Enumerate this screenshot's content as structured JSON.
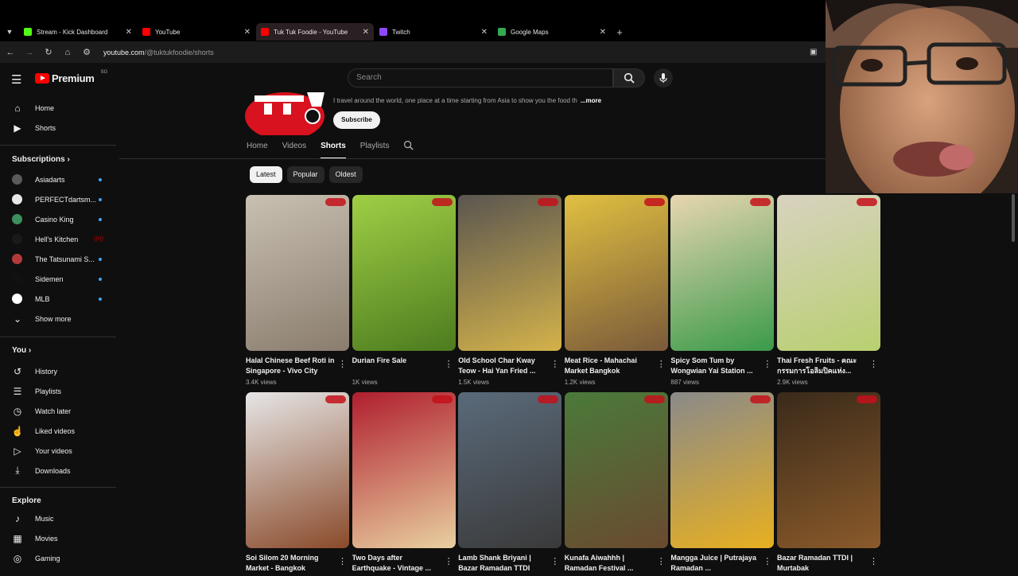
{
  "browser": {
    "tabs": [
      {
        "title": "Stream - Kick Dashboard",
        "color": "#53fc18",
        "active": false
      },
      {
        "title": "YouTube",
        "color": "#ff0000",
        "active": false
      },
      {
        "title": "Tuk Tuk Foodie - YouTube",
        "color": "#ff0000",
        "active": true
      },
      {
        "title": "Twitch",
        "color": "#9146ff",
        "active": false
      },
      {
        "title": "Google Maps",
        "color": "#34a853",
        "active": false
      }
    ],
    "url_host": "youtube.com",
    "url_path": "/@tuktukfoodie/shorts"
  },
  "header": {
    "logo": "Premium",
    "logo_sup": "SG",
    "search_placeholder": "Search"
  },
  "sidebar": {
    "main": [
      {
        "label": "Home",
        "icon": "home-icon"
      },
      {
        "label": "Shorts",
        "icon": "shorts-icon"
      }
    ],
    "subscriptions_title": "Subscriptions",
    "subscriptions": [
      {
        "label": "Asiadarts",
        "avatar_color": "#5a5a5a",
        "status": "dot"
      },
      {
        "label": "PERFECTdartsm...",
        "avatar_color": "#e8e8e8",
        "status": "dot"
      },
      {
        "label": "Casino King",
        "avatar_color": "#3c8f5c",
        "status": "dot"
      },
      {
        "label": "Hell's Kitchen",
        "avatar_color": "#1a1a1a",
        "status": "live"
      },
      {
        "label": "The Tatsunami S...",
        "avatar_color": "#b33a3a",
        "status": "dot"
      },
      {
        "label": "Sidemen",
        "avatar_color": "#111111",
        "status": "dot"
      },
      {
        "label": "MLB",
        "avatar_color": "#ffffff",
        "status": "dot"
      }
    ],
    "show_more": "Show more",
    "you_title": "You",
    "you": [
      {
        "label": "History",
        "icon": "history-icon"
      },
      {
        "label": "Playlists",
        "icon": "playlists-icon"
      },
      {
        "label": "Watch later",
        "icon": "watch-later-icon"
      },
      {
        "label": "Liked videos",
        "icon": "liked-icon"
      },
      {
        "label": "Your videos",
        "icon": "your-videos-icon"
      },
      {
        "label": "Downloads",
        "icon": "download-icon"
      }
    ],
    "explore_title": "Explore",
    "explore": [
      {
        "label": "Music",
        "icon": "music-icon"
      },
      {
        "label": "Movies",
        "icon": "movies-icon"
      },
      {
        "label": "Gaming",
        "icon": "gaming-icon"
      }
    ]
  },
  "channel": {
    "description": "I travel around the world, one place at a time starting from Asia to show you the food th",
    "more_label": "...more",
    "subscribe_label": "Subscribe",
    "tabs": [
      "Home",
      "Videos",
      "Shorts",
      "Playlists"
    ],
    "active_tab": "Shorts"
  },
  "filters": {
    "chips": [
      "Latest",
      "Popular",
      "Oldest"
    ],
    "active": "Latest"
  },
  "shorts": [
    {
      "title": "Halal Chinese Beef Roti in Singapore - Vivo City",
      "views": "3.4K views",
      "c1": "#c9c0b2",
      "c2": "#8a7d6e"
    },
    {
      "title": "Durian Fire Sale",
      "views": "1K views",
      "c1": "#9fcf45",
      "c2": "#4d7b1f"
    },
    {
      "title": "Old School Char Kway Teow - Hai Yan Fried ...",
      "views": "1.5K views",
      "c1": "#5a5650",
      "c2": "#d4b24a"
    },
    {
      "title": "Meat Rice - Mahachai Market Bangkok",
      "views": "1.2K views",
      "c1": "#e0c040",
      "c2": "#7a5a3a"
    },
    {
      "title": "Spicy Som Tum by Wongwian Yai Station ...",
      "views": "887 views",
      "c1": "#e8d6b0",
      "c2": "#3a9a4a"
    },
    {
      "title": "Thai Fresh Fruits - คณะกรรมการโอลิมปิคแห่ง...",
      "views": "2.9K views",
      "c1": "#d8d2c0",
      "c2": "#b8d070"
    },
    {
      "title": "Soi Silom 20 Morning Market - Bangkok",
      "views": "",
      "c1": "#e6e6e6",
      "c2": "#8a4a2a"
    },
    {
      "title": "Two Days after Earthquake - Vintage ...",
      "views": "",
      "c1": "#b01e2e",
      "c2": "#e8d0a0"
    },
    {
      "title": "Lamb Shank Briyani | Bazar Ramadan TTDI",
      "views": "",
      "c1": "#5a6a7a",
      "c2": "#3a3a3a"
    },
    {
      "title": "Kunafa Aiwahhh | Ramadan Festival ...",
      "views": "",
      "c1": "#4a7a3a",
      "c2": "#6a4a30"
    },
    {
      "title": "Mangga Juice | Putrajaya Ramadan ...",
      "views": "",
      "c1": "#8a8a8a",
      "c2": "#e8b020"
    },
    {
      "title": "Bazar Ramadan TTDI | Murtabak",
      "views": "",
      "c1": "#3a2a1a",
      "c2": "#8a5a2a"
    }
  ]
}
